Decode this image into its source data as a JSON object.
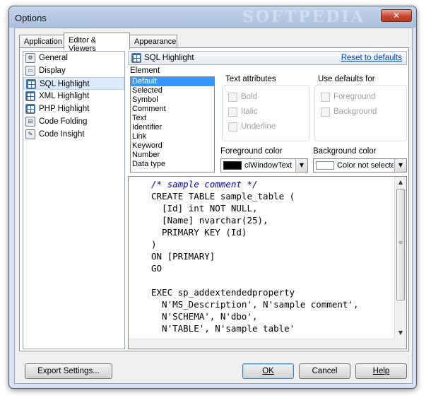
{
  "window": {
    "title": "Options",
    "close_glyph": "✕",
    "watermark": "SOFTPEDIA"
  },
  "tabs": [
    {
      "label": "Application"
    },
    {
      "label": "Editor & Viewers"
    },
    {
      "label": "Appearance"
    }
  ],
  "tree": {
    "items": [
      {
        "label": "General",
        "icon": "gear-icon"
      },
      {
        "label": "Display",
        "icon": "display-icon"
      },
      {
        "label": "SQL Highlight",
        "icon": "grid-icon"
      },
      {
        "label": "XML Highlight",
        "icon": "grid-icon"
      },
      {
        "label": "PHP Highlight",
        "icon": "grid-icon"
      },
      {
        "label": "Code Folding",
        "icon": "code-folding-icon"
      },
      {
        "label": "Code Insight",
        "icon": "code-insight-icon"
      }
    ]
  },
  "header": {
    "title": "SQL Highlight",
    "reset_label": "Reset to defaults"
  },
  "element": {
    "label": "Element",
    "items": [
      "Default",
      "Selected",
      "Symbol",
      "Comment",
      "Text",
      "Identifier",
      "Link",
      "Keyword",
      "Number",
      "Data type"
    ]
  },
  "text_attributes": {
    "label": "Text attributes",
    "bold": "Bold",
    "italic": "Italic",
    "underline": "Underline"
  },
  "use_defaults": {
    "label": "Use defaults for",
    "foreground": "Foreground",
    "background": "Background"
  },
  "foreground": {
    "label": "Foreground color",
    "value": "clWindowText",
    "swatch": "#000000"
  },
  "background": {
    "label": "Background color",
    "value": "Color not selected",
    "swatch": "#ffffff"
  },
  "code": {
    "lines": [
      "/* sample comment */",
      "CREATE TABLE sample_table (",
      "  [Id] int NOT NULL,",
      "  [Name] nvarchar(25),",
      "  PRIMARY KEY (Id)",
      ")",
      "ON [PRIMARY]",
      "GO",
      "",
      "EXEC sp_addextendedproperty",
      "  N'MS_Description', N'sample comment',",
      "  N'SCHEMA', N'dbo',",
      "  N'TABLE', N'sample table'"
    ]
  },
  "buttons": {
    "export": "Export Settings...",
    "ok": "OK",
    "cancel": "Cancel",
    "help": "Help"
  },
  "colors": {
    "accent": "#3399ff",
    "link": "#0645ad"
  }
}
